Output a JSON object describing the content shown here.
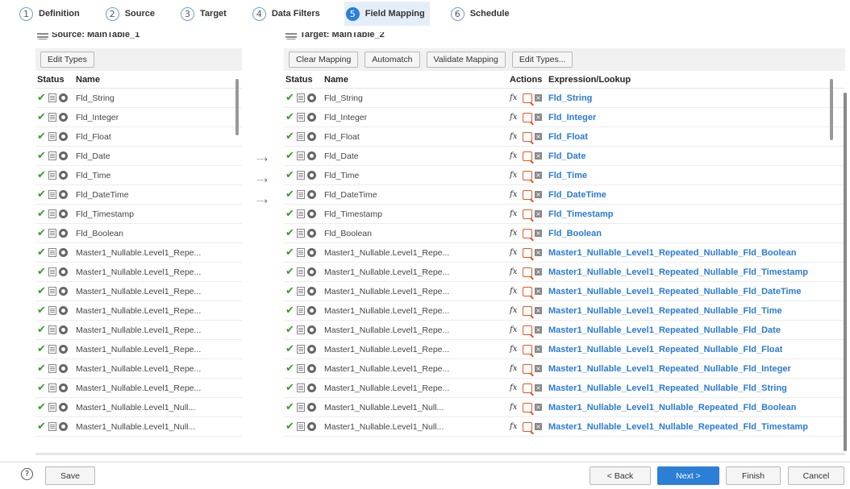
{
  "steps": [
    {
      "num": "1",
      "label": "Definition"
    },
    {
      "num": "2",
      "label": "Source"
    },
    {
      "num": "3",
      "label": "Target"
    },
    {
      "num": "4",
      "label": "Data Filters"
    },
    {
      "num": "5",
      "label": "Field Mapping"
    },
    {
      "num": "6",
      "label": "Schedule"
    }
  ],
  "source": {
    "title": "Source: MainTable_1",
    "buttons": [
      "Edit Types"
    ],
    "columns": {
      "status": "Status",
      "name": "Name"
    },
    "rows": [
      "Fld_String",
      "Fld_Integer",
      "Fld_Float",
      "Fld_Date",
      "Fld_Time",
      "Fld_DateTime",
      "Fld_Timestamp",
      "Fld_Boolean",
      "Master1_Nullable.Level1_Repe...",
      "Master1_Nullable.Level1_Repe...",
      "Master1_Nullable.Level1_Repe...",
      "Master1_Nullable.Level1_Repe...",
      "Master1_Nullable.Level1_Repe...",
      "Master1_Nullable.Level1_Repe...",
      "Master1_Nullable.Level1_Repe...",
      "Master1_Nullable.Level1_Repe...",
      "Master1_Nullable.Level1_Null...",
      "Master1_Nullable.Level1_Null..."
    ]
  },
  "target": {
    "title": "Target: MainTable_2",
    "buttons": [
      "Clear Mapping",
      "Automatch",
      "Validate Mapping",
      "Edit Types..."
    ],
    "columns": {
      "status": "Status",
      "name": "Name",
      "actions": "Actions",
      "expr": "Expression/Lookup"
    },
    "rows": [
      {
        "name": "Fld_String",
        "expr": "Fld_String"
      },
      {
        "name": "Fld_Integer",
        "expr": "Fld_Integer"
      },
      {
        "name": "Fld_Float",
        "expr": "Fld_Float"
      },
      {
        "name": "Fld_Date",
        "expr": "Fld_Date"
      },
      {
        "name": "Fld_Time",
        "expr": "Fld_Time"
      },
      {
        "name": "Fld_DateTime",
        "expr": "Fld_DateTime"
      },
      {
        "name": "Fld_Timestamp",
        "expr": "Fld_Timestamp"
      },
      {
        "name": "Fld_Boolean",
        "expr": "Fld_Boolean"
      },
      {
        "name": "Master1_Nullable.Level1_Repe...",
        "expr": "Master1_Nullable_Level1_Repeated_Nullable_Fld_Boolean"
      },
      {
        "name": "Master1_Nullable.Level1_Repe...",
        "expr": "Master1_Nullable_Level1_Repeated_Nullable_Fld_Timestamp"
      },
      {
        "name": "Master1_Nullable.Level1_Repe...",
        "expr": "Master1_Nullable_Level1_Repeated_Nullable_Fld_DateTime"
      },
      {
        "name": "Master1_Nullable.Level1_Repe...",
        "expr": "Master1_Nullable_Level1_Repeated_Nullable_Fld_Time"
      },
      {
        "name": "Master1_Nullable.Level1_Repe...",
        "expr": "Master1_Nullable_Level1_Repeated_Nullable_Fld_Date"
      },
      {
        "name": "Master1_Nullable.Level1_Repe...",
        "expr": "Master1_Nullable_Level1_Repeated_Nullable_Fld_Float"
      },
      {
        "name": "Master1_Nullable.Level1_Repe...",
        "expr": "Master1_Nullable_Level1_Repeated_Nullable_Fld_Integer"
      },
      {
        "name": "Master1_Nullable.Level1_Repe...",
        "expr": "Master1_Nullable_Level1_Repeated_Nullable_Fld_String"
      },
      {
        "name": "Master1_Nullable.Level1_Null...",
        "expr": "Master1_Nullable_Level1_Nullable_Repeated_Fld_Boolean"
      },
      {
        "name": "Master1_Nullable.Level1_Null...",
        "expr": "Master1_Nullable_Level1_Nullable_Repeated_Fld_Timestamp"
      }
    ]
  },
  "icons": {
    "check": "check-icon",
    "details": "document-icon",
    "settings": "gear-icon",
    "function": "fx-icon",
    "lookup": "lookup-icon",
    "clear": "clear-icon",
    "mapping_arrow": "mapping-arrow-icon",
    "help": "help-icon"
  },
  "glyphs": {
    "check": "✔",
    "fx": "fx",
    "clear": "×",
    "arrow": "⤏",
    "help": "?"
  },
  "footer": {
    "save": "Save",
    "back": "< Back",
    "next": "Next >",
    "finish": "Finish",
    "cancel": "Cancel"
  },
  "colors": {
    "accent": "#2c7fd6",
    "link": "#2a7bd3",
    "check": "#3a9a2e",
    "lookup": "#e0572a"
  }
}
